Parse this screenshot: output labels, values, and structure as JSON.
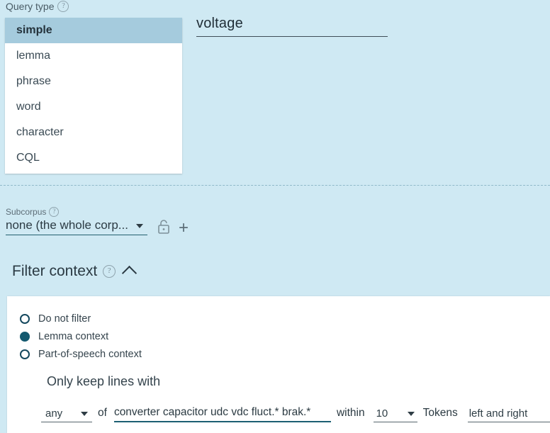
{
  "query_type": {
    "label": "Query type",
    "help_icon": "help-circle-icon",
    "options": [
      {
        "label": "simple",
        "selected": true
      },
      {
        "label": "lemma",
        "selected": false
      },
      {
        "label": "phrase",
        "selected": false
      },
      {
        "label": "word",
        "selected": false
      },
      {
        "label": "character",
        "selected": false
      },
      {
        "label": "CQL",
        "selected": false
      }
    ]
  },
  "query_input": {
    "value": "voltage",
    "placeholder": ""
  },
  "subcorpus": {
    "label": "Subcorpus",
    "help_icon": "help-circle-icon",
    "selected": "none (the whole corp...",
    "lock_icon": "unlock-icon",
    "add_icon": "plus-icon",
    "add_label": "+"
  },
  "filter_context": {
    "title": "Filter context",
    "help_icon": "help-circle-icon",
    "collapse_icon": "chevron-up-icon",
    "radios": [
      {
        "label": "Do not filter",
        "checked": false
      },
      {
        "label": "Lemma context",
        "checked": true
      },
      {
        "label": "Part-of-speech context",
        "checked": false
      }
    ],
    "only_keep_label": "Only keep lines with",
    "controls": {
      "match_mode": "any",
      "of_prefix": "of",
      "filter_terms": "converter capacitor udc vdc fluct.* brak.*",
      "within_label": "within",
      "within_value": "10",
      "tokens_label": "Tokens",
      "side_value": "left and right"
    }
  },
  "colors": {
    "background": "#cfe9f3",
    "panel": "#ffffff",
    "highlight": "#a5cbdd",
    "accent": "#14596f",
    "underline": "#1d6073"
  }
}
